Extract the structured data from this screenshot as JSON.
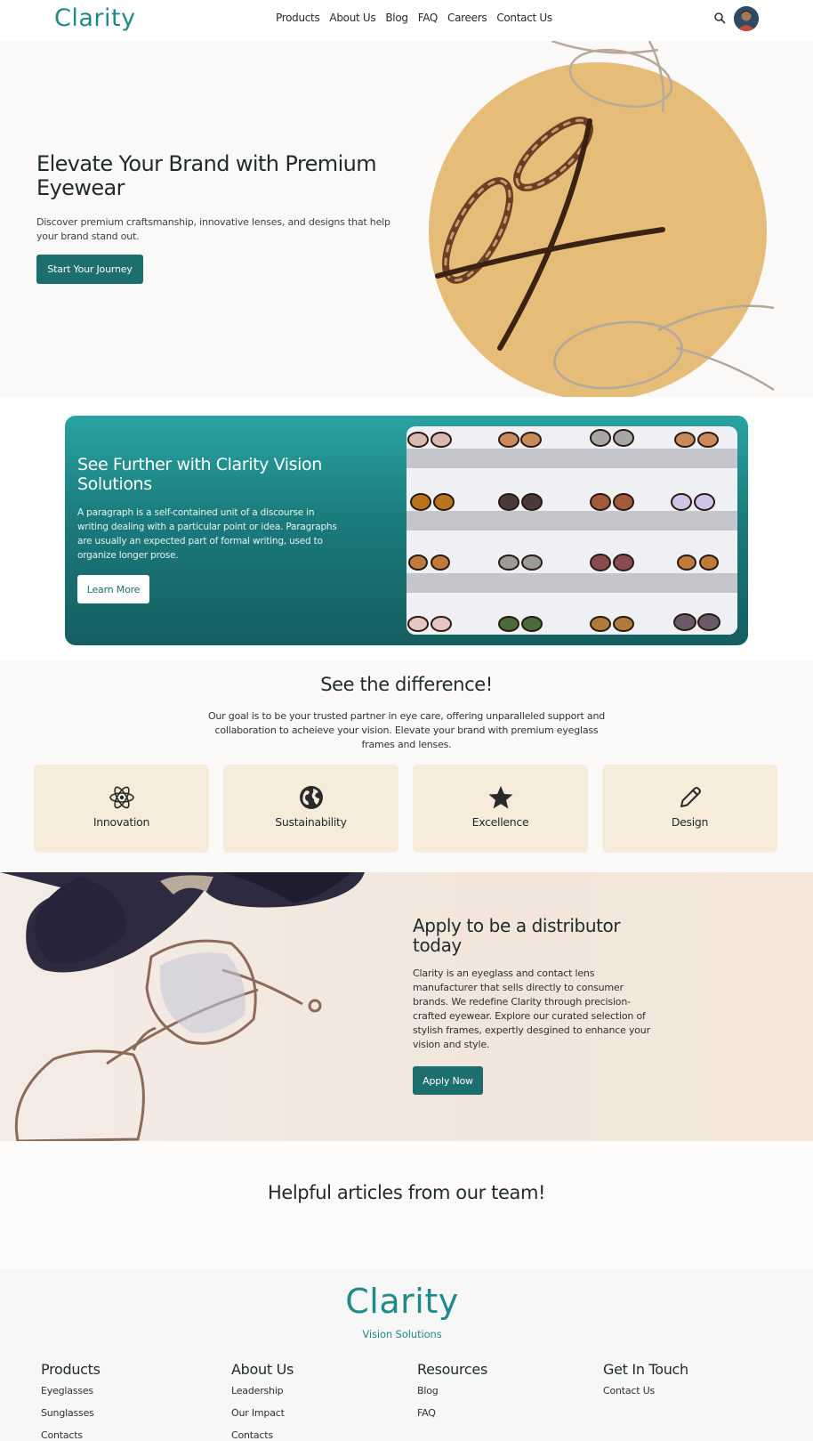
{
  "nav": {
    "logo": "Clarity",
    "links": [
      "Products",
      "About Us",
      "Blog",
      "FAQ",
      "Careers",
      "Contact Us"
    ]
  },
  "hero": {
    "title": "Elevate Your Brand with Premium Eyewear",
    "description": "Discover premium craftsmanship, innovative lenses, and designs that help your brand stand out.",
    "cta": "Start Your Journey"
  },
  "promo": {
    "title": "See Further with Clarity Vision Solutions",
    "description": "A paragraph is a self-contained unit of a discourse in writing dealing with a particular point or idea. Paragraphs are usually an expected part of formal writing, used to organize longer prose.",
    "cta": "Learn More"
  },
  "difference": {
    "title": "See the difference!",
    "description": "Our goal is to be your trusted partner in eye care, offering unparalleled support and collaboration to acheieve your vision. Elevate your brand with premium eyeglass frames and lenses.",
    "cards": [
      {
        "label": "Innovation",
        "icon": "atom-icon"
      },
      {
        "label": "Sustainability",
        "icon": "globe-icon"
      },
      {
        "label": "Excellence",
        "icon": "star-icon"
      },
      {
        "label": "Design",
        "icon": "pencil-icon"
      }
    ]
  },
  "distributor": {
    "title": "Apply to be a distributor today",
    "description": "Clarity is an eyeglass and contact lens manufacturer that sells directly to consumer brands. We redefine Clarity through precision-crafted eyewear. Explore our curated selection of stylish frames, expertly desgined to enhance your vision and style.",
    "cta": "Apply Now"
  },
  "articles": {
    "title": "Helpful articles from our team!"
  },
  "footer": {
    "logo": "Clarity",
    "subtitle": "Vision Solutions",
    "columns": [
      {
        "title": "Products",
        "links": [
          "Eyeglasses",
          "Sunglasses",
          "Contacts"
        ]
      },
      {
        "title": "About Us",
        "links": [
          "Leadership",
          "Our Impact",
          "Contacts"
        ]
      },
      {
        "title": "Resources",
        "links": [
          "Blog",
          "FAQ"
        ]
      },
      {
        "title": "Get In Touch",
        "links": [
          "Contact Us"
        ]
      }
    ]
  },
  "colors": {
    "brand": "#1f8a8a",
    "button": "#1d6e6e",
    "hero_circle": "#e5bd78",
    "card_bg": "#f7ebdc"
  }
}
